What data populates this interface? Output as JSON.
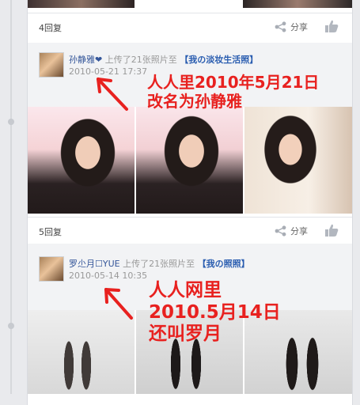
{
  "feed": {
    "post1": {
      "replies": "4回复",
      "share": "分享"
    },
    "entry1": {
      "username": "孙静雅❤",
      "action": "上传了21张照片至",
      "album": "【我の淡妆生活照】",
      "date": "2010-05-21 17:37"
    },
    "post2": {
      "replies": "5回复",
      "share": "分享"
    },
    "entry2": {
      "username": "罗尐月☐YUE",
      "action": "上传了21张照片至",
      "album": "【我の照照】",
      "date": "2010-05-14 10:35"
    }
  },
  "annotations": {
    "note1_line1": "人人里2010年5月21日",
    "note1_line2": "改名为孙静雅",
    "note2_line1": "人人网里",
    "note2_line2": "2010.5月14日",
    "note2_line3": "还叫罗月"
  },
  "colors": {
    "annotation": "#e8211f",
    "link": "#335599",
    "album": "#2a5db0",
    "background": "#e9eaed"
  },
  "icons": [
    "share-icon",
    "thumbs-up-icon",
    "arrow-icon"
  ]
}
